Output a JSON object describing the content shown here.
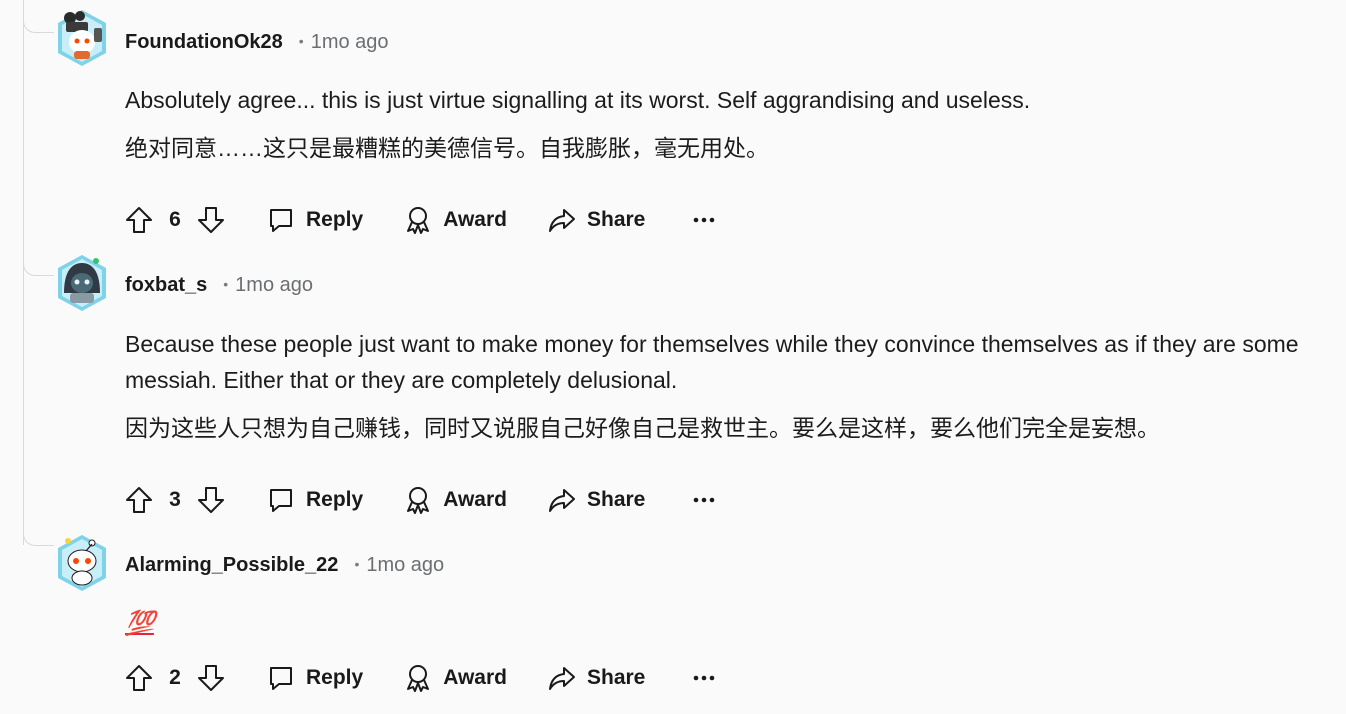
{
  "comments": [
    {
      "username": "FoundationOk28",
      "time": "1mo ago",
      "body": "Absolutely agree... this is just virtue signalling at its worst. Self aggrandising and useless.",
      "translation": "绝对同意……这只是最糟糕的美德信号。自我膨胀，毫无用处。",
      "score": "6",
      "reply_label": "Reply",
      "award_label": "Award",
      "share_label": "Share",
      "avatar_icon": "snoo-avatar-camera"
    },
    {
      "username": "foxbat_s",
      "time": "1mo ago",
      "body": "Because these people just want to make money for themselves while they convince themselves as if they are some messiah. Either that or they are completely delusional.",
      "translation": "因为这些人只想为自己赚钱，同时又说服自己好像自己是救世主。要么是这样，要么他们完全是妄想。",
      "score": "3",
      "reply_label": "Reply",
      "award_label": "Award",
      "share_label": "Share",
      "avatar_icon": "snoo-avatar-hood"
    },
    {
      "username": "Alarming_Possible_22",
      "time": "1mo ago",
      "body": "💯",
      "score": "2",
      "reply_label": "Reply",
      "award_label": "Award",
      "share_label": "Share",
      "avatar_icon": "snoo-avatar-default"
    }
  ],
  "colors": {
    "background": "#fafafa",
    "thread_line": "#d7d9dc",
    "meta_text": "#6b6f72",
    "avatar_ring": "#7fd3e8",
    "hundred_emoji": "#e0263b"
  }
}
